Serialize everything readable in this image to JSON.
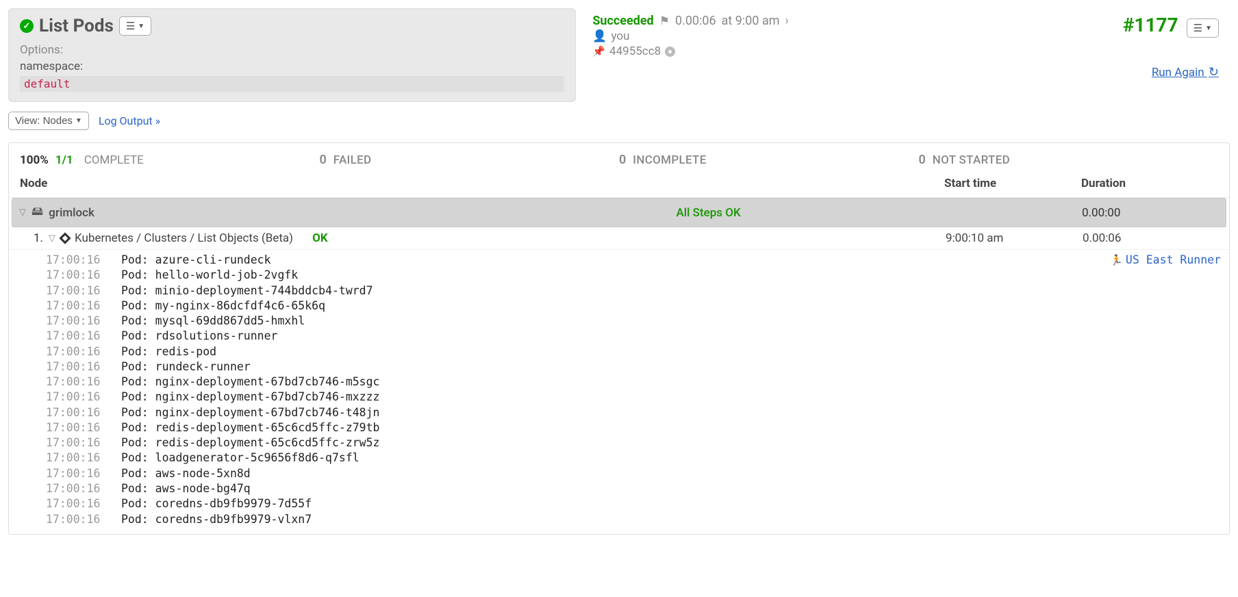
{
  "left_panel": {
    "title": "List Pods",
    "options_label": "Options:",
    "option_key": "namespace:",
    "option_value": "default"
  },
  "right_panel": {
    "status": "Succeeded",
    "duration": "0.00:06",
    "at": "at 9:00 am",
    "user": "you",
    "commit": "44955cc8",
    "exec_id": "#1177",
    "run_again": "Run Again "
  },
  "viewbar": {
    "view_label": "View: Nodes ",
    "log_link": "Log Output »"
  },
  "summary": {
    "percent": "100%",
    "fraction": "1/1",
    "complete": "COMPLETE",
    "failed_n": "0",
    "failed": "FAILED",
    "incomplete_n": "0",
    "incomplete": "INCOMPLETE",
    "notstarted_n": "0",
    "notstarted": "NOT STARTED"
  },
  "headers": {
    "node": "Node",
    "start": "Start time",
    "duration": "Duration"
  },
  "node": {
    "name": "grimlock",
    "status": "All Steps OK",
    "start": "",
    "duration": "0.00:00"
  },
  "step": {
    "index": "1.",
    "path": "Kubernetes / Clusters / List Objects (Beta)",
    "ok": "OK",
    "start": "9:00:10 am",
    "duration": "0.00:06"
  },
  "runner": "US East Runner",
  "log": [
    {
      "ts": "17:00:16",
      "msg": "Pod: azure-cli-rundeck"
    },
    {
      "ts": "17:00:16",
      "msg": "Pod: hello-world-job-2vgfk"
    },
    {
      "ts": "17:00:16",
      "msg": "Pod: minio-deployment-744bddcb4-twrd7"
    },
    {
      "ts": "17:00:16",
      "msg": "Pod: my-nginx-86dcfdf4c6-65k6q"
    },
    {
      "ts": "17:00:16",
      "msg": "Pod: mysql-69dd867dd5-hmxhl"
    },
    {
      "ts": "17:00:16",
      "msg": "Pod: rdsolutions-runner"
    },
    {
      "ts": "17:00:16",
      "msg": "Pod: redis-pod"
    },
    {
      "ts": "17:00:16",
      "msg": "Pod: rundeck-runner"
    },
    {
      "ts": "17:00:16",
      "msg": "Pod: nginx-deployment-67bd7cb746-m5sgc"
    },
    {
      "ts": "17:00:16",
      "msg": "Pod: nginx-deployment-67bd7cb746-mxzzz"
    },
    {
      "ts": "17:00:16",
      "msg": "Pod: nginx-deployment-67bd7cb746-t48jn"
    },
    {
      "ts": "17:00:16",
      "msg": "Pod: redis-deployment-65c6cd5ffc-z79tb"
    },
    {
      "ts": "17:00:16",
      "msg": "Pod: redis-deployment-65c6cd5ffc-zrw5z"
    },
    {
      "ts": "17:00:16",
      "msg": "Pod: loadgenerator-5c9656f8d6-q7sfl"
    },
    {
      "ts": "17:00:16",
      "msg": "Pod: aws-node-5xn8d"
    },
    {
      "ts": "17:00:16",
      "msg": "Pod: aws-node-bg47q"
    },
    {
      "ts": "17:00:16",
      "msg": "Pod: coredns-db9fb9979-7d55f"
    },
    {
      "ts": "17:00:16",
      "msg": "Pod: coredns-db9fb9979-vlxn7"
    }
  ]
}
